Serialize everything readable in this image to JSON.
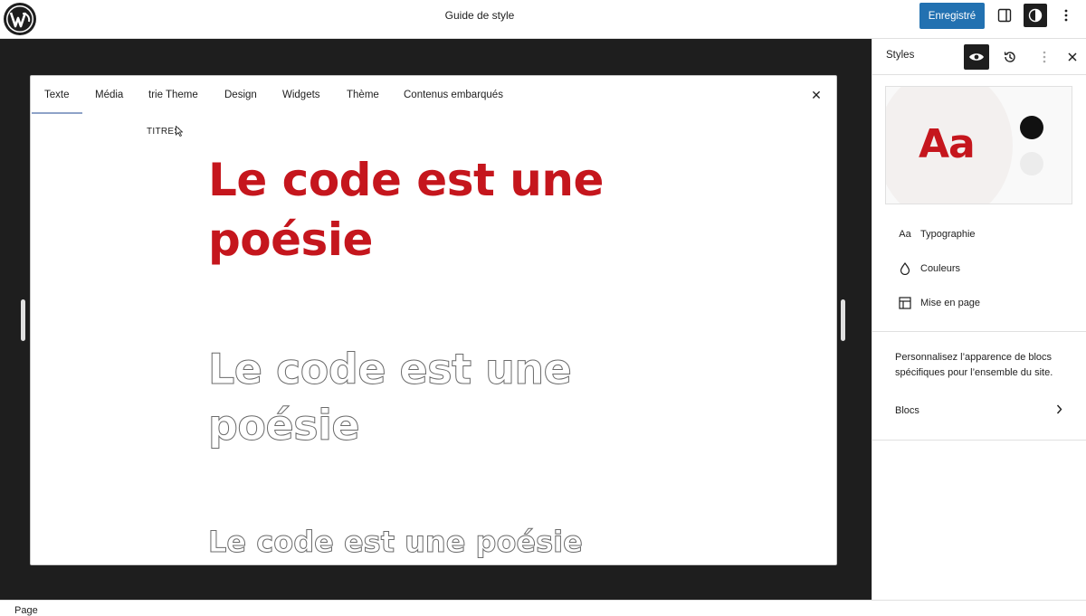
{
  "topbar": {
    "title": "Guide de style",
    "save_label": "Enregistré",
    "icons": [
      "wordpress-logo",
      "sidebar-toggle-icon",
      "styles-icon",
      "more-vertical-icon"
    ]
  },
  "styleguide": {
    "tabs": [
      "Texte",
      "Média",
      "trie Theme",
      "Design",
      "Widgets",
      "Thème",
      "Contenus embarqués"
    ],
    "active_tab": "Texte",
    "section_label": "TITRES",
    "heading_filled": "Le code est une poésie",
    "heading_outline": "Le code est une poésie",
    "heading_outline_small": "Le code est une poésie",
    "heading_color": "#c5161d"
  },
  "sidebar": {
    "title": "Styles",
    "preview_text": "Aa",
    "menu": [
      {
        "label": "Typographie",
        "icon": "typography-icon"
      },
      {
        "label": "Couleurs",
        "icon": "color-drop-icon"
      },
      {
        "label": "Mise en page",
        "icon": "layout-icon"
      }
    ],
    "description": "Personnalisez l’apparence de blocs spécifiques pour l’ensemble du site.",
    "blocks_label": "Blocs"
  },
  "footer": {
    "label": "Page"
  },
  "colors": {
    "accent": "#2271b1",
    "brand_red": "#c5161d",
    "canvas_bg": "#1e1e1e"
  }
}
